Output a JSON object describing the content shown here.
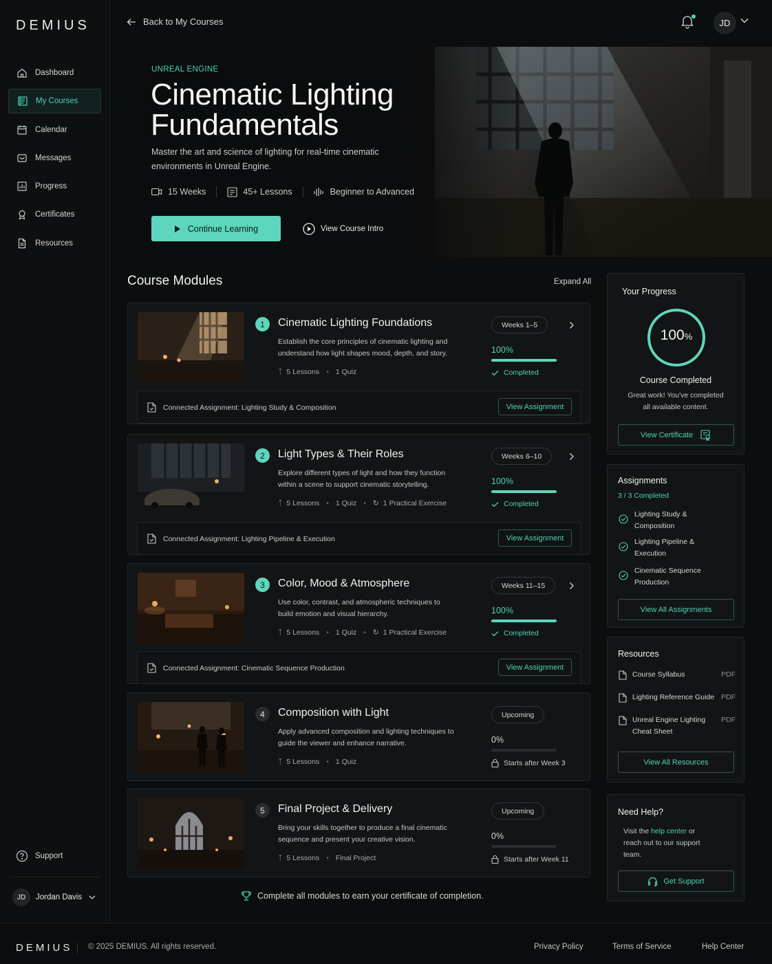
{
  "brand": {
    "logo": "DEMIUS",
    "accent": "#5dd6bd"
  },
  "sidebar": {
    "items": [
      {
        "label": "Dashboard",
        "icon": "home-icon"
      },
      {
        "label": "My Courses",
        "icon": "book-icon",
        "active": true
      },
      {
        "label": "Calendar",
        "icon": "calendar-icon"
      },
      {
        "label": "Messages",
        "icon": "message-icon"
      },
      {
        "label": "Progress",
        "icon": "chart-icon"
      },
      {
        "label": "Certificates",
        "icon": "certificate-icon"
      },
      {
        "label": "Resources",
        "icon": "document-icon"
      }
    ],
    "support": "Support",
    "user": {
      "initials": "JD",
      "name": "Jordan Davis"
    }
  },
  "topbar": {
    "back": "Back to My Courses",
    "avatar": "JD"
  },
  "hero": {
    "eyebrow": "UNREAL ENGINE",
    "title": "Cinematic Lighting Fundamentals",
    "description": "Master the art and science of lighting for real-time cinematic environments in Unreal Engine.",
    "weeks": "15 Weeks",
    "lessons": "45+ Lessons",
    "level": "Beginner to Advanced",
    "primary_btn": "Continue Learning",
    "intro_btn": "View Course Intro"
  },
  "modules_section": {
    "title": "Course Modules",
    "expand": "Expand All"
  },
  "modules": [
    {
      "num": "1",
      "title": "Cinematic Lighting Foundations",
      "desc": "Establish the core principles of cinematic lighting and understand how light shapes mood, depth, and story.",
      "lessons": "5 Lessons",
      "quiz": "1 Quiz",
      "extra": "",
      "weeks": "Weeks 1–5",
      "percent": "100%",
      "progress": 1.0,
      "status": "Completed",
      "assignment": "Connected Assignment: Lighting Study & Composition",
      "assignment_btn": "View Assignment"
    },
    {
      "num": "2",
      "title": "Light Types & Their Roles",
      "desc": "Explore different types of light and how they function within a scene to support cinematic storytelling.",
      "lessons": "5 Lessons",
      "quiz": "1 Quiz",
      "extra": "1 Practical Exercise",
      "weeks": "Weeks 6–10",
      "percent": "100%",
      "progress": 1.0,
      "status": "Completed",
      "assignment": "Connected Assignment: Lighting Pipeline & Execution",
      "assignment_btn": "View Assignment"
    },
    {
      "num": "3",
      "title": "Color, Mood & Atmosphere",
      "desc": "Use color, contrast, and atmospheric techniques to build emotion and visual hierarchy.",
      "lessons": "5 Lessons",
      "quiz": "1 Quiz",
      "extra": "1 Practical Exercise",
      "weeks": "Weeks 11–15",
      "percent": "100%",
      "progress": 1.0,
      "status": "Completed",
      "assignment": "Connected Assignment: Cinematic Sequence Production",
      "assignment_btn": "View Assignment"
    },
    {
      "num": "4",
      "title": "Composition with Light",
      "desc": "Apply advanced composition and lighting techniques to guide the viewer and enhance narrative.",
      "lessons": "5 Lessons",
      "quiz": "1 Quiz",
      "extra": "",
      "weeks": "Upcoming",
      "percent": "0%",
      "progress": 0,
      "status": "Starts after Week 3"
    },
    {
      "num": "5",
      "title": "Final Project & Delivery",
      "desc": "Bring your skills together to produce a final cinematic sequence and present your creative vision.",
      "lessons": "5 Lessons",
      "quiz": "Final Project",
      "extra": "",
      "weeks": "Upcoming",
      "percent": "0%",
      "progress": 0,
      "status": "Starts after Week 11"
    }
  ],
  "completion_note": "Complete all modules to earn your certificate of completion.",
  "progress_card": {
    "title": "Your Progress",
    "value": "100",
    "unit": "%",
    "progress": 1.0,
    "heading": "Course Completed",
    "text": "Great work! You've completed all available content.",
    "button": "View Certificate"
  },
  "assignments_card": {
    "title": "Assignments",
    "count": "3 / 3 Completed",
    "items": [
      "Lighting Study & Composition",
      "Lighting Pipeline & Execution",
      "Cinematic Sequence Production"
    ],
    "button": "View All Assignments"
  },
  "resources_card": {
    "title": "Resources",
    "items": [
      {
        "name": "Course Syllabus",
        "type": "PDF"
      },
      {
        "name": "Lighting Reference Guide",
        "type": "PDF"
      },
      {
        "name": "Unreal Engine Lighting Cheat Sheet",
        "type": "PDF"
      }
    ],
    "button": "View All Resources"
  },
  "help_card": {
    "title": "Need Help?",
    "text_before": "Visit the ",
    "link": "help center",
    "text_after": " or reach out to our support team.",
    "button": "Get Support"
  },
  "footer": {
    "logo": "DEMIUS",
    "copyright": "© 2025 DEMIUS. All rights reserved.",
    "links": [
      "Privacy Policy",
      "Terms of Service",
      "Help Center"
    ]
  }
}
